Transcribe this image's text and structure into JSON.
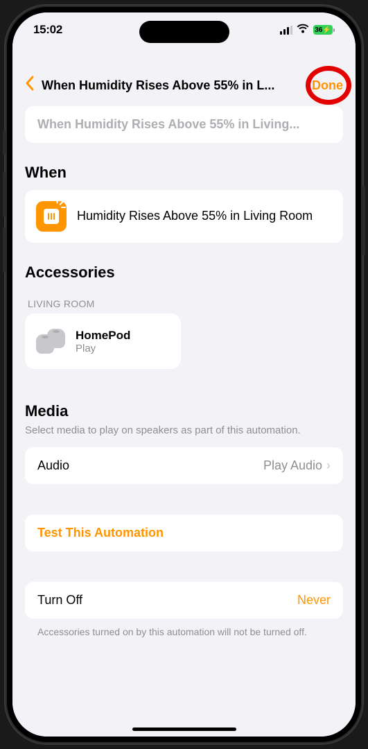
{
  "status_bar": {
    "time": "15:02",
    "battery": "36"
  },
  "header": {
    "title": "When Humidity Rises Above 55% in L...",
    "done": "Done"
  },
  "name_field": {
    "placeholder": "When Humidity Rises Above 55% in Living..."
  },
  "when": {
    "title": "When",
    "condition": "Humidity Rises Above 55% in Living Room"
  },
  "accessories": {
    "title": "Accessories",
    "room": "LIVING ROOM",
    "items": [
      {
        "name": "HomePod",
        "action": "Play"
      }
    ]
  },
  "media": {
    "title": "Media",
    "subtitle": "Select media to play on speakers as part of this automation.",
    "row_label": "Audio",
    "row_value": "Play Audio"
  },
  "test": {
    "label": "Test This Automation"
  },
  "turnoff": {
    "label": "Turn Off",
    "value": "Never",
    "footer": "Accessories turned on by this automation will not be turned off."
  }
}
